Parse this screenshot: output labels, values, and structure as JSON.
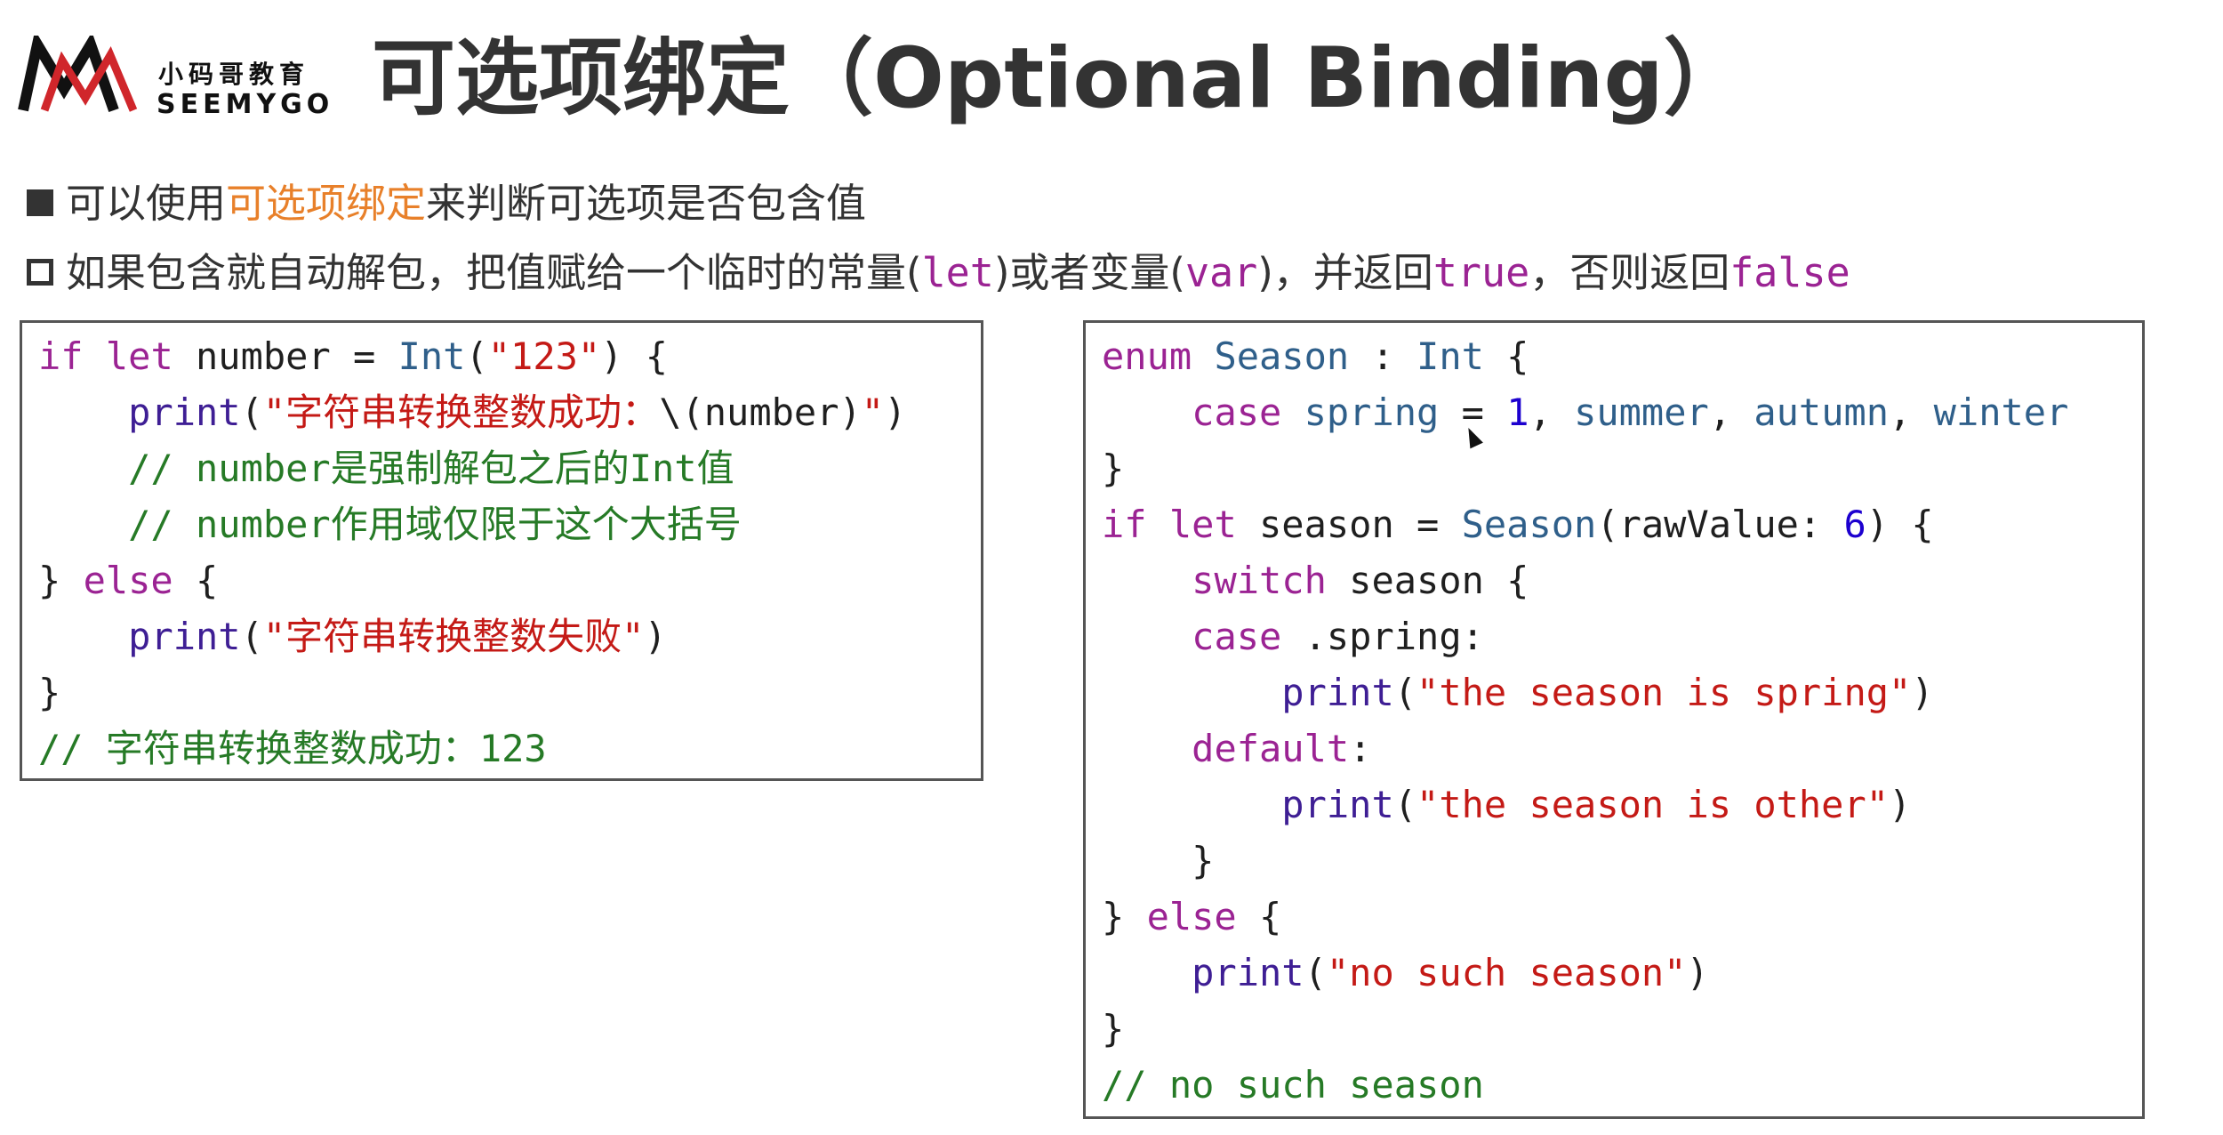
{
  "header": {
    "logo_cn": "小码哥教育",
    "logo_en": "SEEMYGO",
    "title": "可选项绑定（Optional Binding）"
  },
  "bullets": {
    "b1_prefix": "可以使用",
    "b1_highlight": "可选项绑定",
    "b1_suffix": "来判断可选项是否包含值",
    "b2_t1": "如果包含就自动解包，把值赋给一个临时的常量(",
    "b2_let": "let",
    "b2_t2": ")或者变量(",
    "b2_var": "var",
    "b2_t3": ")，并返回",
    "b2_true": "true",
    "b2_t4": "，否则返回",
    "b2_false": "false"
  },
  "code_left": [
    [
      {
        "t": "if",
        "c": "kw"
      },
      {
        "t": " ",
        "c": "id"
      },
      {
        "t": "let",
        "c": "kw"
      },
      {
        "t": " number = ",
        "c": "id"
      },
      {
        "t": "Int",
        "c": "ty"
      },
      {
        "t": "(",
        "c": "id"
      },
      {
        "t": "\"123\"",
        "c": "str"
      },
      {
        "t": ") {",
        "c": "id"
      }
    ],
    [
      {
        "t": "    ",
        "c": "id"
      },
      {
        "t": "print",
        "c": "fn"
      },
      {
        "t": "(",
        "c": "id"
      },
      {
        "t": "\"字符串转换整数成功：",
        "c": "str"
      },
      {
        "t": "\\(number)",
        "c": "id"
      },
      {
        "t": "\"",
        "c": "str"
      },
      {
        "t": ")",
        "c": "id"
      }
    ],
    [
      {
        "t": "    // number是强制解包之后的Int值",
        "c": "cm"
      }
    ],
    [
      {
        "t": "    // number作用域仅限于这个大括号",
        "c": "cm"
      }
    ],
    [
      {
        "t": "} ",
        "c": "id"
      },
      {
        "t": "else",
        "c": "kw"
      },
      {
        "t": " {",
        "c": "id"
      }
    ],
    [
      {
        "t": "    ",
        "c": "id"
      },
      {
        "t": "print",
        "c": "fn"
      },
      {
        "t": "(",
        "c": "id"
      },
      {
        "t": "\"字符串转换整数失败\"",
        "c": "str"
      },
      {
        "t": ")",
        "c": "id"
      }
    ],
    [
      {
        "t": "}",
        "c": "id"
      }
    ],
    [
      {
        "t": "// 字符串转换整数成功：123",
        "c": "cm"
      }
    ]
  ],
  "code_right": [
    [
      {
        "t": "enum",
        "c": "kw"
      },
      {
        "t": " ",
        "c": "id"
      },
      {
        "t": "Season",
        "c": "ty"
      },
      {
        "t": " : ",
        "c": "id"
      },
      {
        "t": "Int",
        "c": "ty"
      },
      {
        "t": " {",
        "c": "id"
      }
    ],
    [
      {
        "t": "    ",
        "c": "id"
      },
      {
        "t": "case",
        "c": "kw"
      },
      {
        "t": " ",
        "c": "id"
      },
      {
        "t": "spring",
        "c": "member"
      },
      {
        "t": " = ",
        "c": "id"
      },
      {
        "t": "1",
        "c": "num"
      },
      {
        "t": ", ",
        "c": "id"
      },
      {
        "t": "summer",
        "c": "member"
      },
      {
        "t": ", ",
        "c": "id"
      },
      {
        "t": "autumn",
        "c": "member"
      },
      {
        "t": ", ",
        "c": "id"
      },
      {
        "t": "winter",
        "c": "member"
      }
    ],
    [
      {
        "t": "}",
        "c": "id"
      }
    ],
    [
      {
        "t": "if",
        "c": "kw"
      },
      {
        "t": " ",
        "c": "id"
      },
      {
        "t": "let",
        "c": "kw"
      },
      {
        "t": " season = ",
        "c": "id"
      },
      {
        "t": "Season",
        "c": "ty"
      },
      {
        "t": "(rawValue: ",
        "c": "id"
      },
      {
        "t": "6",
        "c": "num"
      },
      {
        "t": ") {",
        "c": "id"
      }
    ],
    [
      {
        "t": "    ",
        "c": "id"
      },
      {
        "t": "switch",
        "c": "kw"
      },
      {
        "t": " season {",
        "c": "id"
      }
    ],
    [
      {
        "t": "    ",
        "c": "id"
      },
      {
        "t": "case",
        "c": "kw"
      },
      {
        "t": " .spring:",
        "c": "id"
      }
    ],
    [
      {
        "t": "        ",
        "c": "id"
      },
      {
        "t": "print",
        "c": "fn"
      },
      {
        "t": "(",
        "c": "id"
      },
      {
        "t": "\"the season is spring\"",
        "c": "str"
      },
      {
        "t": ")",
        "c": "id"
      }
    ],
    [
      {
        "t": "    ",
        "c": "id"
      },
      {
        "t": "default",
        "c": "kw"
      },
      {
        "t": ":",
        "c": "id"
      }
    ],
    [
      {
        "t": "        ",
        "c": "id"
      },
      {
        "t": "print",
        "c": "fn"
      },
      {
        "t": "(",
        "c": "id"
      },
      {
        "t": "\"the season is other\"",
        "c": "str"
      },
      {
        "t": ")",
        "c": "id"
      }
    ],
    [
      {
        "t": "    }",
        "c": "id"
      }
    ],
    [
      {
        "t": "} ",
        "c": "id"
      },
      {
        "t": "else",
        "c": "kw"
      },
      {
        "t": " {",
        "c": "id"
      }
    ],
    [
      {
        "t": "    ",
        "c": "id"
      },
      {
        "t": "print",
        "c": "fn"
      },
      {
        "t": "(",
        "c": "id"
      },
      {
        "t": "\"no such season\"",
        "c": "str"
      },
      {
        "t": ")",
        "c": "id"
      }
    ],
    [
      {
        "t": "}",
        "c": "id"
      }
    ],
    [
      {
        "t": "// no such season",
        "c": "cm"
      }
    ]
  ],
  "colors": {
    "keyword": "#9b2393",
    "type": "#2f5f8a",
    "function": "#3e1e94",
    "string": "#c41a16",
    "number": "#1c00cf",
    "comment": "#267a26",
    "highlight": "#e8802a"
  },
  "icons": [
    "logo-m-icon",
    "filled-square-bullet-icon",
    "hollow-square-bullet-icon",
    "mouse-cursor-icon"
  ]
}
